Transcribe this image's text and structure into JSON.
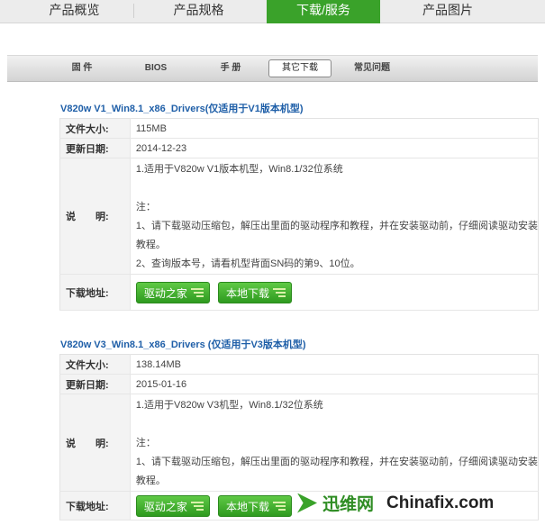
{
  "top_tabs": [
    {
      "label": "产品概览",
      "active": false
    },
    {
      "label": "产品规格",
      "active": false
    },
    {
      "label": "下载/服务",
      "active": true
    },
    {
      "label": "产品图片",
      "active": false
    }
  ],
  "sub_tabs": [
    {
      "label": "固 件",
      "active": false
    },
    {
      "label": "BIOS",
      "active": false
    },
    {
      "label": "手 册",
      "active": false
    },
    {
      "label": "其它下载",
      "active": true
    },
    {
      "label": "常见问题",
      "active": false
    }
  ],
  "labels": {
    "size": "文件大小:",
    "date": "更新日期:",
    "desc": "说　　明:",
    "download": "下载地址:"
  },
  "sections": [
    {
      "title": "V820w V1_Win8.1_x86_Drivers(仅适用于V1版本机型)",
      "size": "115MB",
      "date": "2014-12-23",
      "desc_lines": [
        "1.适用于V820w V1版本机型，Win8.1/32位系统",
        "",
        "注：",
        "1、请下载驱动压缩包，解压出里面的驱动程序和教程，并在安装驱动前，仔细阅读驱动安装",
        "教程。",
        "2、查询版本号，请看机型背面SN码的第9、10位。"
      ],
      "buttons": [
        "驱动之家",
        "本地下载"
      ]
    },
    {
      "title": "V820w V3_Win8.1_x86_Drivers (仅适用于V3版本机型)",
      "size": "138.14MB",
      "date": "2015-01-16",
      "desc_lines": [
        "1.适用于V820w V3机型，Win8.1/32位系统",
        "",
        "注：",
        "1、请下载驱动压缩包，解压出里面的驱动程序和教程，并在安装驱动前，仔细阅读驱动安装",
        "教程。"
      ],
      "buttons": [
        "驱动之家",
        "本地下载"
      ]
    }
  ],
  "watermark": {
    "cn": "迅维网",
    "en": "Chinafix.com"
  }
}
